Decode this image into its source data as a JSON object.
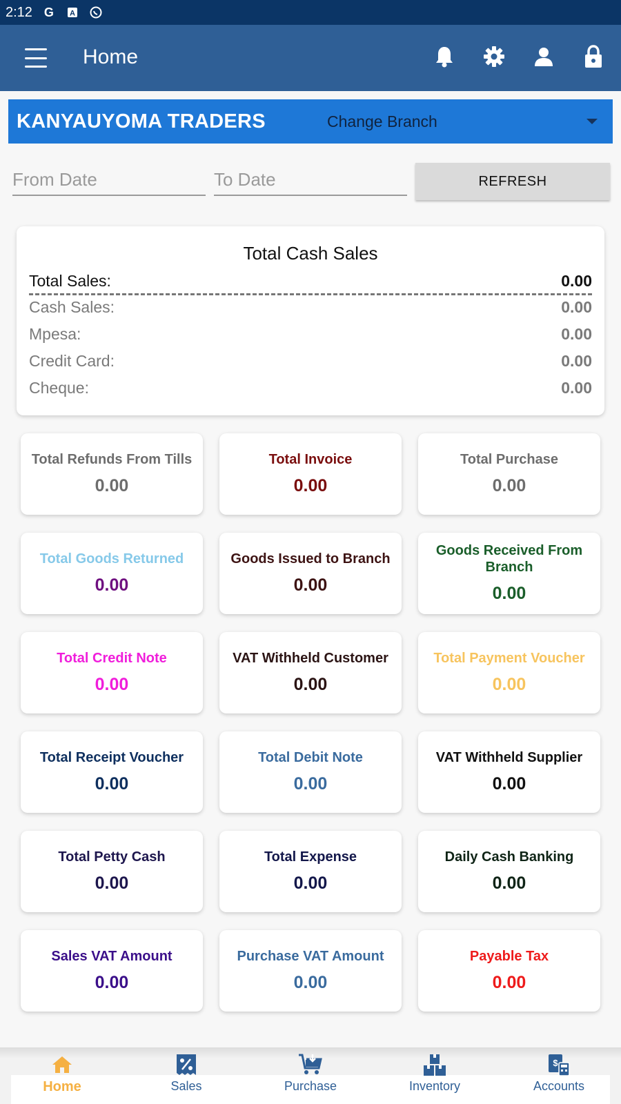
{
  "status_bar": {
    "time": "2:12",
    "icons": [
      "google-icon",
      "font-icon",
      "whatsapp-icon"
    ]
  },
  "app_bar": {
    "title": "Home",
    "actions": [
      "bell-icon",
      "gear-icon",
      "person-icon",
      "lock-icon"
    ]
  },
  "branch": {
    "company": "KANYAUYOMA TRADERS",
    "select_label": "Change Branch"
  },
  "filters": {
    "from_placeholder": "From Date",
    "to_placeholder": "To Date",
    "refresh_label": "REFRESH"
  },
  "cash_sales": {
    "title": "Total Cash Sales",
    "total_label": "Total Sales:",
    "total_value": "0.00",
    "rows": [
      {
        "label": "Cash Sales:",
        "value": "0.00"
      },
      {
        "label": "Mpesa:",
        "value": "0.00"
      },
      {
        "label": "Credit Card:",
        "value": "0.00"
      },
      {
        "label": "Cheque:",
        "value": "0.00"
      }
    ]
  },
  "stats": [
    {
      "title": "Total Refunds From Tills",
      "value": "0.00",
      "title_color": "#6d6d6d",
      "value_color": "#6d6d6d"
    },
    {
      "title": "Total Invoice",
      "value": "0.00",
      "title_color": "#7a0e0e",
      "value_color": "#7a0e0e"
    },
    {
      "title": "Total Purchase",
      "value": "0.00",
      "title_color": "#6d6d6d",
      "value_color": "#6d6d6d"
    },
    {
      "title": "Total Goods Returned",
      "value": "0.00",
      "title_color": "#86c9e9",
      "value_color": "#6f1080"
    },
    {
      "title": "Goods Issued to Branch",
      "value": "0.00",
      "title_color": "#3d1313",
      "value_color": "#3d1313"
    },
    {
      "title": "Goods Received From Branch",
      "value": "0.00",
      "title_color": "#1a5e2a",
      "value_color": "#1a5e2a"
    },
    {
      "title": "Total Credit Note",
      "value": "0.00",
      "title_color": "#f01edb",
      "value_color": "#f01edb"
    },
    {
      "title": "VAT Withheld Customer",
      "value": "0.00",
      "title_color": "#2b1414",
      "value_color": "#2b1414"
    },
    {
      "title": "Total Payment Voucher",
      "value": "0.00",
      "title_color": "#f7c45e",
      "value_color": "#f7c45e"
    },
    {
      "title": "Total Receipt Voucher",
      "value": "0.00",
      "title_color": "#0e2f5e",
      "value_color": "#0e2f5e"
    },
    {
      "title": "Total Debit Note",
      "value": "0.00",
      "title_color": "#3a6b9e",
      "value_color": "#3a6b9e"
    },
    {
      "title": "VAT Withheld Supplier",
      "value": "0.00",
      "title_color": "#111111",
      "value_color": "#111111"
    },
    {
      "title": "Total Petty Cash",
      "value": "0.00",
      "title_color": "#1d164d",
      "value_color": "#1d164d"
    },
    {
      "title": "Total Expense",
      "value": "0.00",
      "title_color": "#13174a",
      "value_color": "#13174a"
    },
    {
      "title": "Daily Cash Banking",
      "value": "0.00",
      "title_color": "#0f2416",
      "value_color": "#0f2416"
    },
    {
      "title": "Sales VAT Amount",
      "value": "0.00",
      "title_color": "#3b0f8a",
      "value_color": "#3b0f8a"
    },
    {
      "title": "Purchase VAT Amount",
      "value": "0.00",
      "title_color": "#3a6b9e",
      "value_color": "#3a6b9e"
    },
    {
      "title": "Payable Tax",
      "value": "0.00",
      "title_color": "#ee1b1b",
      "value_color": "#ee1b1b"
    }
  ],
  "bottom_nav": [
    {
      "label": "Home",
      "icon": "home-icon",
      "active": true
    },
    {
      "label": "Sales",
      "icon": "percent-receipt-icon",
      "active": false
    },
    {
      "label": "Purchase",
      "icon": "cart-icon",
      "active": false
    },
    {
      "label": "Inventory",
      "icon": "boxes-icon",
      "active": false
    },
    {
      "label": "Accounts",
      "icon": "calculator-icon",
      "active": false
    }
  ],
  "colors": {
    "status_bar": "#0b3566",
    "app_bar": "#2f5f96",
    "branch_bar": "#1e78d7",
    "nav_active": "#f5b042",
    "nav_inactive": "#2f5f96"
  }
}
